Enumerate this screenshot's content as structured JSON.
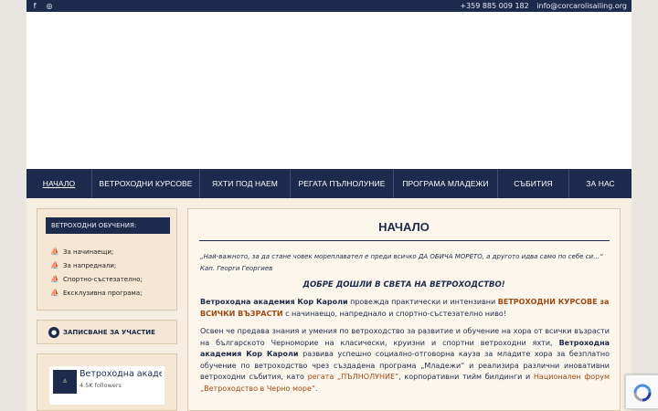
{
  "topbar": {
    "social": [
      {
        "icon": "facebook-icon",
        "glyph": "f"
      },
      {
        "icon": "instagram-icon",
        "glyph": "◎"
      }
    ],
    "phone": "+359 885 009 182",
    "email": "info@corcarolisailing.org"
  },
  "nav": [
    {
      "label": "НАЧАЛО",
      "active": true
    },
    {
      "label": "ВЕТРОХОДНИ КУРСОВЕ"
    },
    {
      "label": "ЯХТИ ПОД НАЕМ"
    },
    {
      "label": "РЕГАТА ПЪЛНОЛУНИЕ"
    },
    {
      "label": "ПРОГРАМА МЛАДЕЖИ"
    },
    {
      "label": "СЪБИТИЯ"
    },
    {
      "label": "ЗА НАС"
    }
  ],
  "sidebar": {
    "trainings": {
      "heading": "ВЕТРОХОДНИ ОБУЧЕНИЯ:",
      "items": [
        {
          "label": "За начинаещи;",
          "icon": "sailboat-icon"
        },
        {
          "label": "За напреднали;",
          "icon": "sailboat-icon"
        },
        {
          "label": "Спортно-състезателно;",
          "icon": "sailboat-icon"
        },
        {
          "label": "Ексклузивна програма;",
          "icon": "sailboat-icon"
        }
      ]
    },
    "signup": {
      "label": "ЗАПИСВАНЕ ЗА УЧАСТИЕ",
      "icon": "user-icon"
    },
    "facebook": {
      "name": "Ветроходна академия Кор Кароли",
      "followers": "4.5K followers"
    }
  },
  "main": {
    "title": "НАЧАЛО",
    "quote": "„Най-важното, за да стане човек мореплавател е преди всичко ДА ОБИЧА МОРЕТО, а другото идва само по себе си…“  Кап. Георги Георгиев",
    "welcome": "ДОБРЕ ДОШЛИ В СВЕТА НА ВЕТРОХОДСТВО!",
    "p1": {
      "academy": "Ветроходна академия Кор Кароли",
      "t1": "  провежда практически и интензивни ",
      "courses": "ВЕТРОХОДНИ КУРСОВЕ за ВСИЧКИ ВЪЗРАСТИ",
      "t2": " с начинаещо, напреднало и спортно-състезателно ниво!"
    },
    "p2": {
      "t1": "Освен че предава знания и умения по ветроходство за развитие и обучение на хора от всички възрасти на българското Черноморие на класически, круизни и спортни ветроходни яхти, ",
      "academy": "Ветроходна академия Кор Кароли",
      "t2": " развива успешно социално-отговорна кауза за младите хора за безплатно обучение по ветроходство чрез създадена програма „Младежи“ и реализира различни иновативни ветроходни събития, като ",
      "link1": "регата „ПЪЛНОЛУНИЕ“",
      "t3": ", корпоративни тийм билдинги и ",
      "link2": "Национален форум „Ветроходство в Черно море“",
      "t4": "."
    }
  },
  "colors": {
    "navy": "#1c2b4b",
    "accent": "#9c4a14",
    "panel": "#f5e7d3",
    "page": "#f7eee2"
  }
}
